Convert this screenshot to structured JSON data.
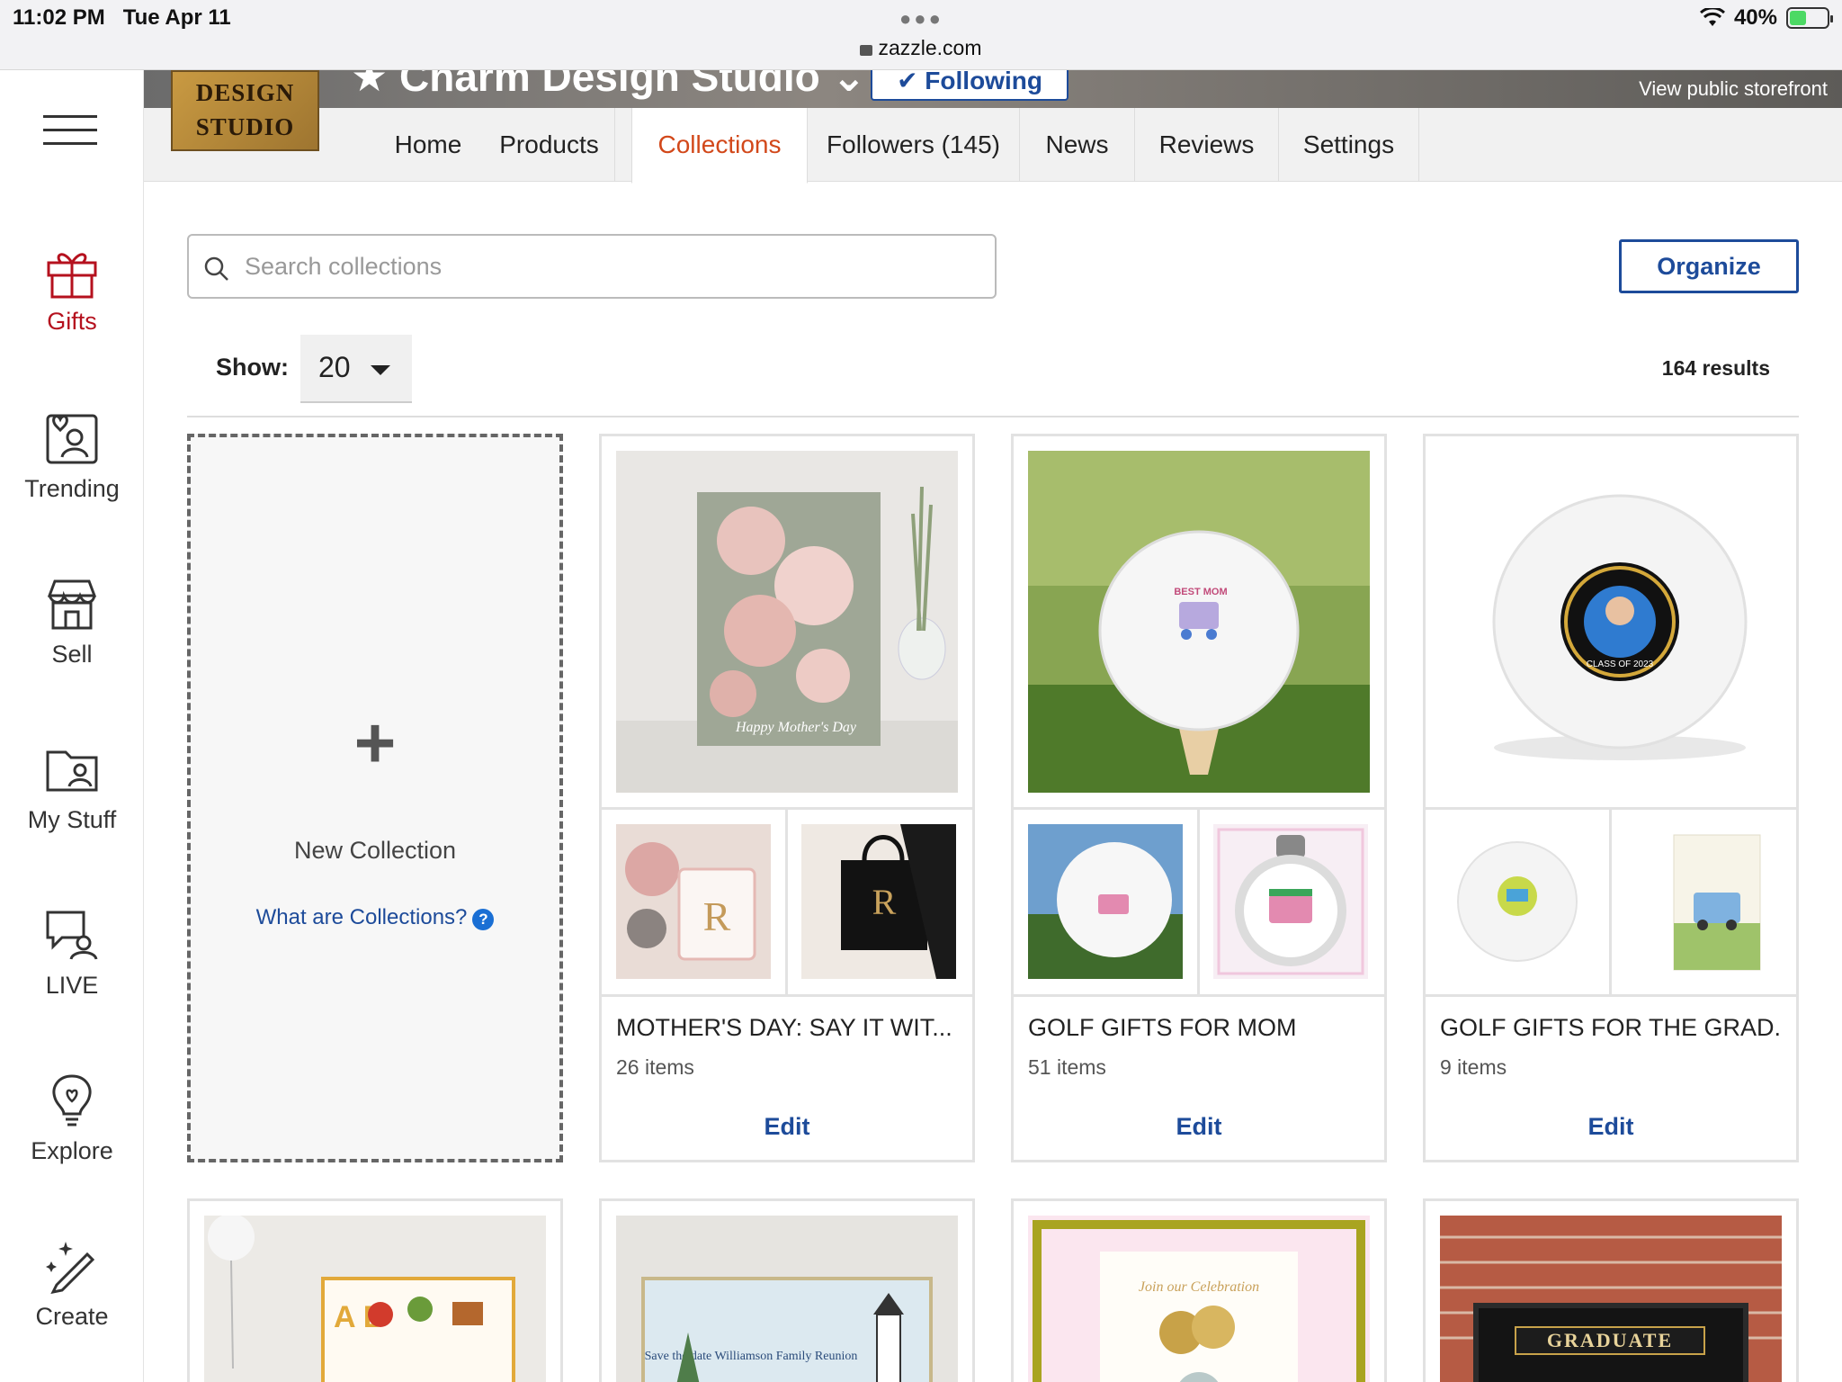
{
  "status_bar": {
    "time": "11:02 PM",
    "date": "Tue Apr 11",
    "url": "zazzle.com",
    "battery": "40%"
  },
  "rail": {
    "items": [
      {
        "label": "Gifts",
        "icon": "gift-icon",
        "active": true
      },
      {
        "label": "Trending",
        "icon": "trending-icon"
      },
      {
        "label": "Sell",
        "icon": "storefront-icon"
      },
      {
        "label": "My Stuff",
        "icon": "folder-icon"
      },
      {
        "label": "LIVE",
        "icon": "live-chat-icon"
      },
      {
        "label": "Explore",
        "icon": "lightbulb-icon"
      },
      {
        "label": "Create",
        "icon": "magic-pen-icon"
      }
    ]
  },
  "store": {
    "logo_line1": "DESIGN",
    "logo_line2": "STUDIO",
    "name": "Charm Design Studio",
    "follow_label": "✔ Following",
    "storefront_link": "View public storefront"
  },
  "tabs": [
    {
      "label": "Home"
    },
    {
      "label": "Products"
    },
    {
      "label": "Collections",
      "active": true
    },
    {
      "label": "Followers (145)"
    },
    {
      "label": "News"
    },
    {
      "label": "Reviews"
    },
    {
      "label": "Settings"
    }
  ],
  "search": {
    "placeholder": "Search collections",
    "value": ""
  },
  "organize_label": "Organize",
  "show": {
    "label": "Show:",
    "value": "20"
  },
  "results_text": "164 results",
  "new_collection": {
    "plus": "+",
    "title": "New Collection",
    "help": "What are Collections?",
    "help_icon": "?"
  },
  "collections": [
    {
      "title": "MOTHER'S DAY: SAY IT WIT...",
      "count": "26 items",
      "edit": "Edit",
      "card_text": "Happy Mother's Day"
    },
    {
      "title": "GOLF GIFTS FOR MOM",
      "count": "51 items",
      "edit": "Edit",
      "card_text": "BEST MOM"
    },
    {
      "title": "GOLF GIFTS FOR THE GRAD...",
      "count": "9 items",
      "edit": "Edit",
      "card_text": "CLASS OF 2023"
    }
  ],
  "row2": [
    {
      "text": "A B"
    },
    {
      "text": "Save the date Williamson Family Reunion"
    },
    {
      "text": "Join our Celebration"
    },
    {
      "text": "GRADUATE"
    }
  ]
}
